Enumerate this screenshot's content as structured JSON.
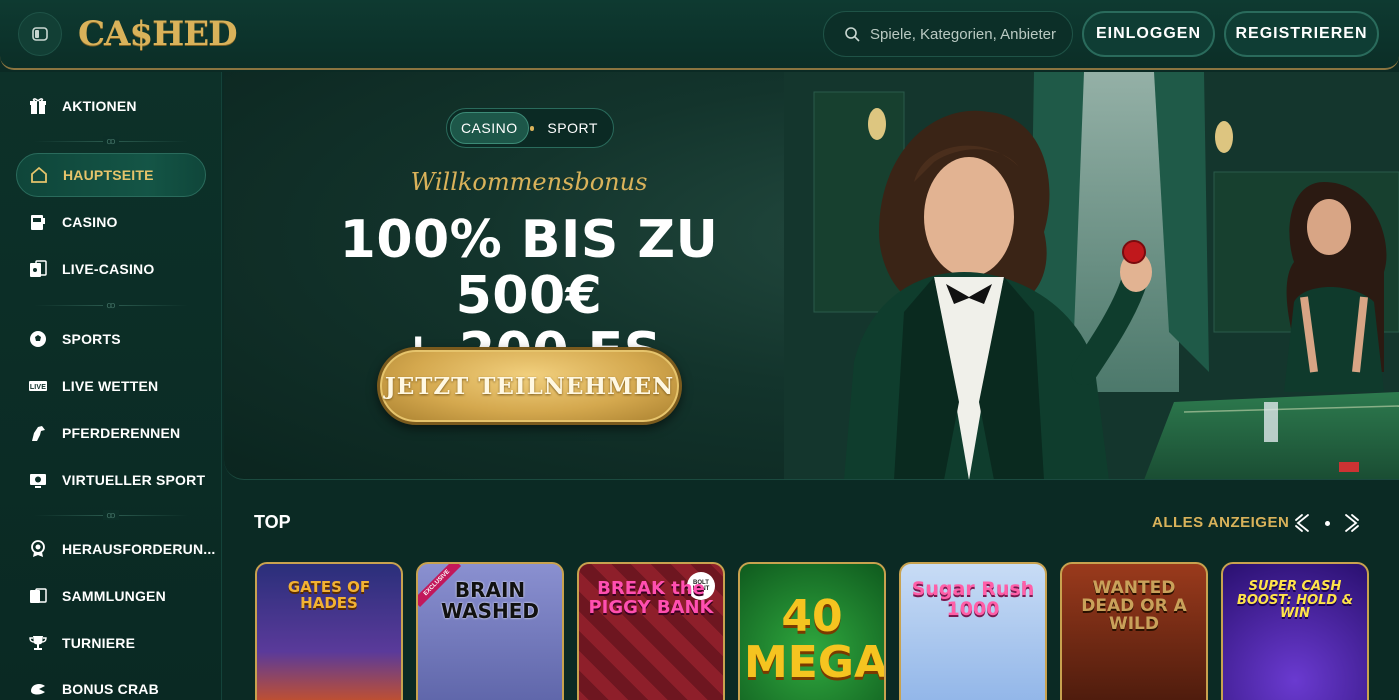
{
  "header": {
    "logo": "CA$HED",
    "search_placeholder": "Spiele, Kategorien, Anbieter",
    "login_label": "EINLOGGEN",
    "register_label": "REGISTRIEREN"
  },
  "sidebar": {
    "items": [
      {
        "label": "AKTIONEN",
        "icon": "gift-icon"
      },
      {
        "label": "HAUPTSEITE",
        "icon": "home-icon",
        "active": true
      },
      {
        "label": "CASINO",
        "icon": "slot-machine-icon"
      },
      {
        "label": "LIVE-CASINO",
        "icon": "live-cards-icon"
      },
      {
        "label": "SPORTS",
        "icon": "soccer-ball-icon"
      },
      {
        "label": "LIVE WETTEN",
        "icon": "live-badge-icon"
      },
      {
        "label": "PFERDERENNEN",
        "icon": "horse-icon"
      },
      {
        "label": "VIRTUELLER SPORT",
        "icon": "virtual-sport-icon"
      },
      {
        "label": "HERAUSFORDERUN...",
        "icon": "medal-icon"
      },
      {
        "label": "SAMMLUNGEN",
        "icon": "collections-icon"
      },
      {
        "label": "TURNIERE",
        "icon": "trophy-icon"
      },
      {
        "label": "BONUS CRAB",
        "icon": "crab-claw-icon"
      }
    ]
  },
  "banner": {
    "tab_casino": "CASINO",
    "tab_sport": "SPORT",
    "welcome": "Willkommensbonus",
    "headline_line1": "100% BIS ZU 500€",
    "headline_line2": "+ 200 FS",
    "cta_label": "JETZT TEILNEHMEN"
  },
  "top_section": {
    "title": "TOP",
    "view_all": "ALLES ANZEIGEN",
    "games": [
      {
        "title": "GATES OF HADES",
        "bg": "#3a3f8f",
        "color": "#f2b233"
      },
      {
        "title": "BRAIN WASHED",
        "bg": "#7f86c9",
        "color": "#1a1a1a",
        "badge": "EXCLUSIVE"
      },
      {
        "title": "BREAK the PIGGY BANK",
        "bg": "#8e1f2a",
        "color": "#ff4fb0",
        "badge": "BOLT HUNT"
      },
      {
        "title": "40 MEGA",
        "bg": "#1d7a2a",
        "color": "#f5c420"
      },
      {
        "title": "Sugar Rush 1000",
        "bg": "#a9c9f0",
        "color": "#ff5fa8"
      },
      {
        "title": "WANTED DEAD OR A WILD",
        "bg": "#8a3a1c",
        "color": "#c9a15a"
      },
      {
        "title": "SUPER CASH BOOST: HOLD & WIN",
        "bg": "#3a1e8a",
        "color": "#ffe44a"
      }
    ]
  }
}
